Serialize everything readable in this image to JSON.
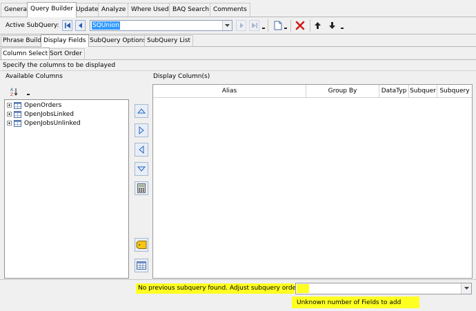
{
  "top_tabs": [
    "General",
    "Query Builder",
    "Update",
    "Analyze",
    "Where Used",
    "BAQ Search",
    "Comments"
  ],
  "toolbar": {
    "active_label": "Active SubQuery:",
    "active_value": "SQUnion"
  },
  "sub_tabs": [
    "Phrase Build",
    "Display Fields",
    "SubQuery Options",
    "SubQuery List"
  ],
  "inner_tabs": [
    "Column Select",
    "Sort Order"
  ],
  "instruction": "Specify the columns to be displayed",
  "available": {
    "label": "Available Columns",
    "sort_glyph": "A↓Z",
    "items": [
      "OpenOrders",
      "OpenJobsLinked",
      "OpenJobsUnlinked"
    ]
  },
  "display": {
    "label": "Display Column(s)",
    "headers": [
      "Alias",
      "Group By",
      "DataTyp",
      "Subquer",
      "Subquery"
    ]
  },
  "status": {
    "message": "No previous subquery found. Adjust subquery order!",
    "combo_value": "",
    "fields_note": "Unknown number of Fields to add",
    "highlight_color": "#ffff22"
  },
  "icons": [
    "first-icon",
    "prev-icon",
    "next-icon",
    "last-icon",
    "new-icon",
    "delete-icon",
    "move-up-icon",
    "move-down-icon",
    "sort-az-icon",
    "up-arrow-icon",
    "right-arrow-icon",
    "left-arrow-icon",
    "down-arrow-icon",
    "calculator-icon",
    "tag-icon",
    "table-grid-icon"
  ]
}
